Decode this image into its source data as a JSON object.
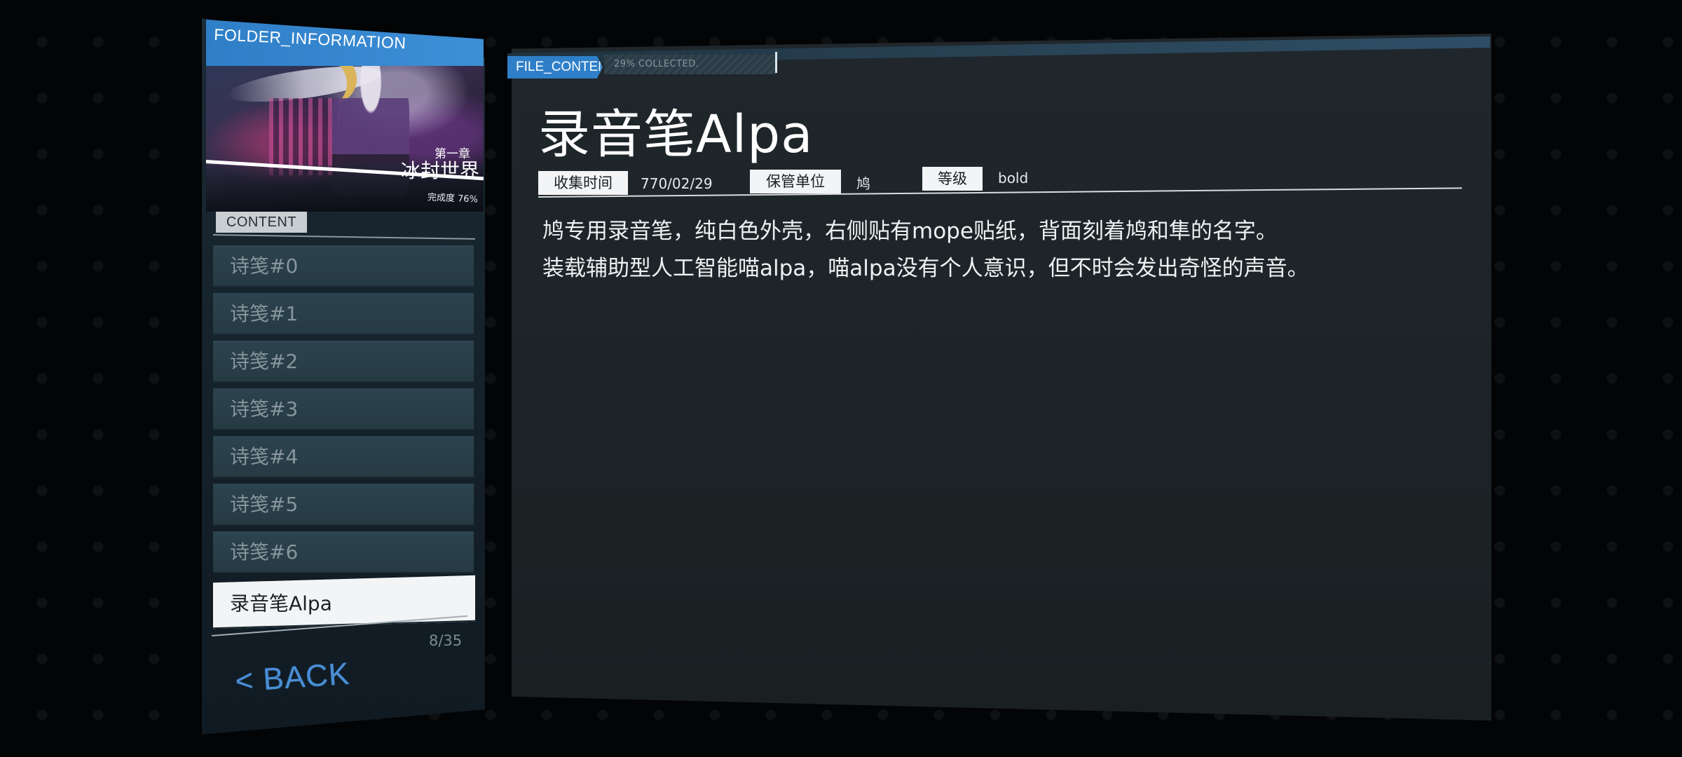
{
  "folder": {
    "header": "FOLDER_INFORMATION",
    "chapter_sub": "第一章",
    "chapter_title": "冰封世界",
    "completion": "完成度 76%"
  },
  "content": {
    "tab_label": "CONTENT",
    "items": [
      {
        "label": "诗笺#0"
      },
      {
        "label": "诗笺#1"
      },
      {
        "label": "诗笺#2"
      },
      {
        "label": "诗笺#3"
      },
      {
        "label": "诗笺#4"
      },
      {
        "label": "诗笺#5"
      },
      {
        "label": "诗笺#6"
      },
      {
        "label": "录音笔Alpa"
      }
    ],
    "count": "8/35",
    "back_label": "< BACK"
  },
  "file": {
    "tab_label": "FILE_CONTENT",
    "collected_text": "29% COLLECTED.",
    "collected_fraction": 0.29,
    "title": "录音笔Alpa",
    "meta": {
      "time_label": "收集时间",
      "time_value": "770/02/29",
      "unit_label": "保管单位",
      "unit_value": "鸠",
      "level_label": "等级",
      "level_value": "bold"
    },
    "description": [
      "鸠专用录音笔，纯白色外壳，右侧贴有mope贴纸，背面刻着鸠和隼的名字。",
      "装载辅助型人工智能喵alpa，喵alpa没有个人意识，但不时会发出奇怪的声音。"
    ]
  },
  "colors": {
    "accent_blue": "#2f7fc8",
    "back_blue": "#4a8fd6",
    "active_item_bg": "#f3f4f5",
    "panel_bg": "#1d2326"
  }
}
